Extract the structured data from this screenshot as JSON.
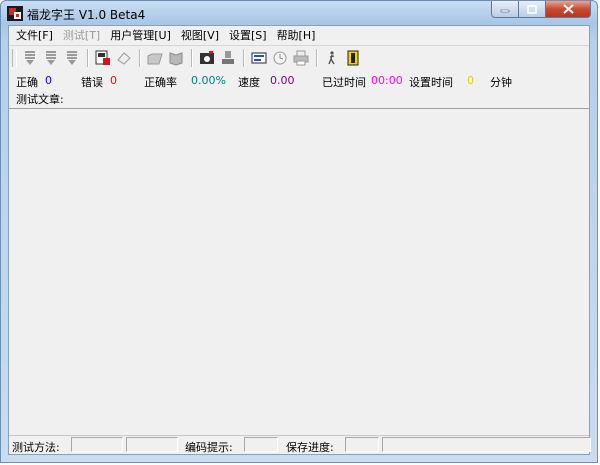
{
  "window": {
    "title": "福龙字王 V1.0 Beta4"
  },
  "menu": [
    {
      "label": "文件[F]",
      "enabled": true
    },
    {
      "label": "测试[T]",
      "enabled": false
    },
    {
      "label": "用户管理[U]",
      "enabled": true
    },
    {
      "label": "视图[V]",
      "enabled": true
    },
    {
      "label": "设置[S]",
      "enabled": true
    },
    {
      "label": "帮助[H]",
      "enabled": true
    }
  ],
  "toolbar_icons": [
    "list-down-icon-1",
    "list-down-icon-2",
    "list-down-icon-3",
    "save-icon",
    "eraser-icon",
    "folder-icon",
    "book-icon",
    "camera-icon",
    "stamp-icon",
    "keyboard-icon",
    "clock-icon",
    "printer-icon",
    "figure-icon",
    "exit-icon"
  ],
  "stats": {
    "correct_label": "正确",
    "correct_value": "0",
    "wrong_label": "错误",
    "wrong_value": "0",
    "accuracy_label": "正确率",
    "accuracy_value": "0.00%",
    "speed_label": "速度",
    "speed_value": "0.00",
    "elapsed_label": "已过时间",
    "elapsed_value": "00:00",
    "set_time_label": "设置时间",
    "set_time_value": "0",
    "minutes_label": "分钟",
    "article_label": "测试文章:"
  },
  "colors": {
    "correct": "#0000ff",
    "wrong": "#ff0000",
    "accuracy": "#008080",
    "speed": "#800080",
    "elapsed": "#ff00ff",
    "set_time": "#e0d000"
  },
  "status": {
    "method_label": "测试方法:",
    "code_hint_label": "编码提示:",
    "save_progress_label": "保存进度:"
  }
}
